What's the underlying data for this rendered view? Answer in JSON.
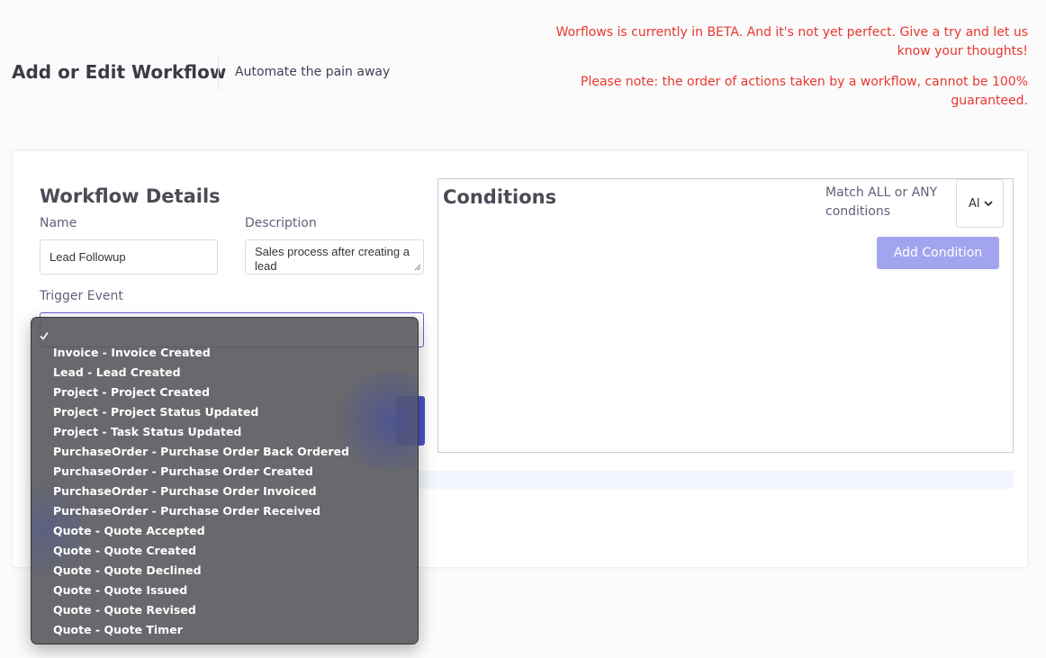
{
  "header": {
    "title": "Add or Edit Workflow",
    "subtitle": "Automate the pain away",
    "beta_notice": "Worflows is currently in BETA. And it's not yet perfect. Give a try and let us know your thoughts!",
    "order_notice": "Please note: the order of actions taken by a workflow, cannot be 100% guaranteed."
  },
  "workflow_details": {
    "heading": "Workflow Details",
    "name_label": "Name",
    "name_value": "Lead Followup",
    "description_label": "Description",
    "description_value": "Sales process after creating a lead",
    "trigger_label": "Trigger Event"
  },
  "conditions": {
    "heading": "Conditions",
    "match_label": "Match ALL or ANY conditions",
    "match_value": "Al",
    "add_button": "Add Condition"
  },
  "trigger_dropdown": {
    "selected_index": 0,
    "options": [
      "",
      "Invoice - Invoice Created",
      "Lead - Lead Created",
      "Project - Project Created",
      "Project - Project Status Updated",
      "Project - Task Status Updated",
      "PurchaseOrder - Purchase Order Back Ordered",
      "PurchaseOrder - Purchase Order Created",
      "PurchaseOrder - Purchase Order Invoiced",
      "PurchaseOrder - Purchase Order Received",
      "Quote - Quote Accepted",
      "Quote - Quote Created",
      "Quote - Quote Declined",
      "Quote - Quote Issued",
      "Quote - Quote Revised",
      "Quote - Quote Timer"
    ]
  },
  "colors": {
    "notice": "#e8372c",
    "accent": "#6a63d8",
    "add_button": "#a3a4ee",
    "primary_button": "#4953c9"
  }
}
